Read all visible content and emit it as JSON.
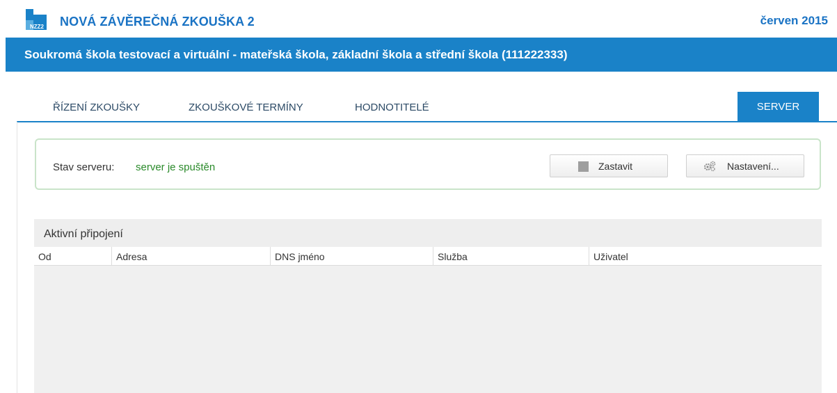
{
  "header": {
    "logo_text": "NZZ2",
    "title": "NOVÁ ZÁVĚREČNÁ ZKOUŠKA 2",
    "date": "červen 2015"
  },
  "school_bar": {
    "name": "Soukromá škola testovací a virtuální - mateřská škola, základní škola a střední škola (111222333)"
  },
  "tabs": [
    {
      "label": "ŘÍZENÍ ZKOUŠKY",
      "active": false
    },
    {
      "label": "ZKOUŠKOVÉ TERMÍNY",
      "active": false
    },
    {
      "label": "HODNOTITELÉ",
      "active": false
    },
    {
      "label": "SERVER",
      "active": true
    }
  ],
  "server_status": {
    "label": "Stav serveru:",
    "value": "server je spuštěn",
    "stop_button": "Zastavit",
    "settings_button": "Nastavení..."
  },
  "connections": {
    "title": "Aktivní připojení",
    "columns": [
      "Od",
      "Adresa",
      "DNS jméno",
      "Služba",
      "Uživatel"
    ],
    "rows": []
  },
  "colors": {
    "brand_blue": "#1a82c8",
    "title_blue": "#1a73c4",
    "status_green": "#2a8a2a"
  },
  "icons": [
    "nzz2-logo-icon",
    "stop-icon",
    "gears-icon"
  ]
}
